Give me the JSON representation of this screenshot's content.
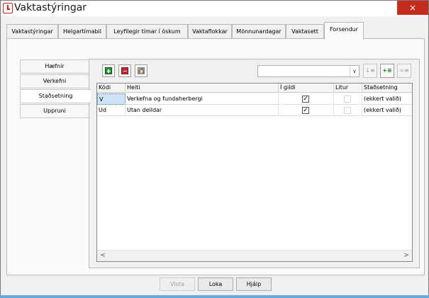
{
  "window": {
    "title": "Vaktastýringar",
    "close_glyph": "×"
  },
  "tabs": [
    {
      "label": "Vaktastýringar"
    },
    {
      "label": "Helgartímabil"
    },
    {
      "label": "Leyfilegir tímar í óskum"
    },
    {
      "label": "Vaktaflokkar"
    },
    {
      "label": "Mönnunardagar"
    },
    {
      "label": "Vaktasett"
    },
    {
      "label": "Forsendur"
    }
  ],
  "active_tab": "Forsendur",
  "side_nav": [
    {
      "label": "Hæfnir"
    },
    {
      "label": "Verkefni"
    },
    {
      "label": "Staðsetning"
    },
    {
      "label": "Uppruni"
    }
  ],
  "active_side": "Staðsetning",
  "toolbar": {
    "add_icon": "add-row-icon",
    "remove_icon": "remove-row-icon",
    "grid_icon": "color-grid-icon",
    "combo_value": "",
    "combo_arrow": "∨",
    "sort_asc_glyph": "↓≡",
    "add_sort_glyph": "+≡",
    "clear_sort_glyph": "=≡"
  },
  "grid": {
    "columns": [
      "Kódi",
      "Heiti",
      "Í gildi",
      "Litur",
      "Staðsetning"
    ],
    "rows": [
      {
        "code": "V",
        "name": "Verkefna og fundaherbergi",
        "active": "✓",
        "color": "",
        "location": "(ekkert valið)"
      },
      {
        "code": "Ud",
        "name": "Utan deildar",
        "active": "✓",
        "color": "",
        "location": "(ekkert valið)"
      }
    ],
    "scroll_left": "<",
    "scroll_right": ">"
  },
  "buttons": {
    "vista": "Vista",
    "loka": "Loka",
    "hjalp": "Hjálp"
  }
}
